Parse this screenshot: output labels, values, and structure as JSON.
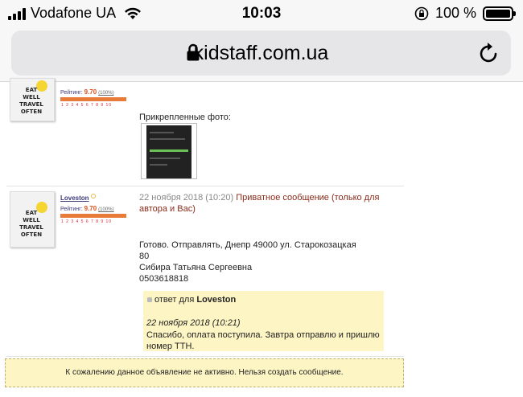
{
  "status_bar": {
    "carrier": "Vodafone UA",
    "time": "10:03",
    "battery": "100 %",
    "battery_level": 1.0
  },
  "address_bar": {
    "url": "kidstaff.com.ua"
  },
  "post1": {
    "rating_label": "Рейтинг:",
    "rating_value": "9.70",
    "rating_pct": "(100%)",
    "rating_scale": "1 2 3 4 5 6 7 8 9 10",
    "attached_label": "Прикрепленные фото:",
    "avatar_text": "EAT WELL TRAVEL OFTEN"
  },
  "post2": {
    "username": "Loveston",
    "rating_label": "Рейтинг:",
    "rating_value": "9.70",
    "rating_pct": "(100%)",
    "rating_scale": "1 2 3 4 5 6 7 8 9 10",
    "avatar_text": "EAT WELL TRAVEL OFTEN",
    "date": "22 ноября 2018 (10:20)",
    "private_label": "Приватное сообщение (только для автора и Вас)",
    "message_line1": "Готово. Отправлять, Днепр 49000 ул. Старокозацкая",
    "message_line2": "80",
    "message_line3": "Сибира Татьяна Сергеевна",
    "message_line4": "0503618818"
  },
  "reply": {
    "prefix": "ответ для",
    "to_user": "Loveston",
    "date": "22 ноября 2018 (10:21)",
    "text": "Спасибо, оплата поступила. Завтра отправлю и пришлю номер ТТН."
  },
  "notice": {
    "text": "К сожалению данное объявление не активно. Нельзя создать сообщение."
  }
}
